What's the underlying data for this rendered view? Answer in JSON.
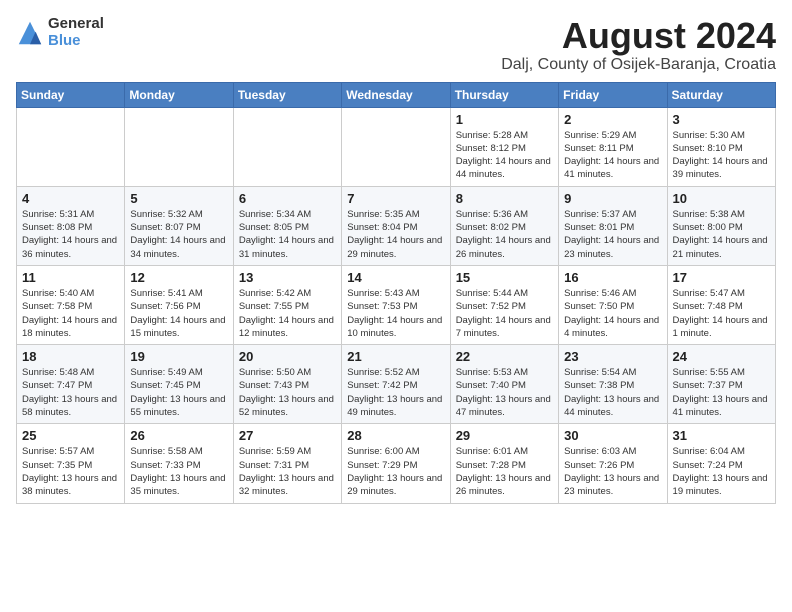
{
  "logo": {
    "general": "General",
    "blue": "Blue"
  },
  "title": "August 2024",
  "subtitle": "Dalj, County of Osijek-Baranja, Croatia",
  "days_of_week": [
    "Sunday",
    "Monday",
    "Tuesday",
    "Wednesday",
    "Thursday",
    "Friday",
    "Saturday"
  ],
  "weeks": [
    [
      {
        "day": "",
        "info": ""
      },
      {
        "day": "",
        "info": ""
      },
      {
        "day": "",
        "info": ""
      },
      {
        "day": "",
        "info": ""
      },
      {
        "day": "1",
        "info": "Sunrise: 5:28 AM\nSunset: 8:12 PM\nDaylight: 14 hours and 44 minutes."
      },
      {
        "day": "2",
        "info": "Sunrise: 5:29 AM\nSunset: 8:11 PM\nDaylight: 14 hours and 41 minutes."
      },
      {
        "day": "3",
        "info": "Sunrise: 5:30 AM\nSunset: 8:10 PM\nDaylight: 14 hours and 39 minutes."
      }
    ],
    [
      {
        "day": "4",
        "info": "Sunrise: 5:31 AM\nSunset: 8:08 PM\nDaylight: 14 hours and 36 minutes."
      },
      {
        "day": "5",
        "info": "Sunrise: 5:32 AM\nSunset: 8:07 PM\nDaylight: 14 hours and 34 minutes."
      },
      {
        "day": "6",
        "info": "Sunrise: 5:34 AM\nSunset: 8:05 PM\nDaylight: 14 hours and 31 minutes."
      },
      {
        "day": "7",
        "info": "Sunrise: 5:35 AM\nSunset: 8:04 PM\nDaylight: 14 hours and 29 minutes."
      },
      {
        "day": "8",
        "info": "Sunrise: 5:36 AM\nSunset: 8:02 PM\nDaylight: 14 hours and 26 minutes."
      },
      {
        "day": "9",
        "info": "Sunrise: 5:37 AM\nSunset: 8:01 PM\nDaylight: 14 hours and 23 minutes."
      },
      {
        "day": "10",
        "info": "Sunrise: 5:38 AM\nSunset: 8:00 PM\nDaylight: 14 hours and 21 minutes."
      }
    ],
    [
      {
        "day": "11",
        "info": "Sunrise: 5:40 AM\nSunset: 7:58 PM\nDaylight: 14 hours and 18 minutes."
      },
      {
        "day": "12",
        "info": "Sunrise: 5:41 AM\nSunset: 7:56 PM\nDaylight: 14 hours and 15 minutes."
      },
      {
        "day": "13",
        "info": "Sunrise: 5:42 AM\nSunset: 7:55 PM\nDaylight: 14 hours and 12 minutes."
      },
      {
        "day": "14",
        "info": "Sunrise: 5:43 AM\nSunset: 7:53 PM\nDaylight: 14 hours and 10 minutes."
      },
      {
        "day": "15",
        "info": "Sunrise: 5:44 AM\nSunset: 7:52 PM\nDaylight: 14 hours and 7 minutes."
      },
      {
        "day": "16",
        "info": "Sunrise: 5:46 AM\nSunset: 7:50 PM\nDaylight: 14 hours and 4 minutes."
      },
      {
        "day": "17",
        "info": "Sunrise: 5:47 AM\nSunset: 7:48 PM\nDaylight: 14 hours and 1 minute."
      }
    ],
    [
      {
        "day": "18",
        "info": "Sunrise: 5:48 AM\nSunset: 7:47 PM\nDaylight: 13 hours and 58 minutes."
      },
      {
        "day": "19",
        "info": "Sunrise: 5:49 AM\nSunset: 7:45 PM\nDaylight: 13 hours and 55 minutes."
      },
      {
        "day": "20",
        "info": "Sunrise: 5:50 AM\nSunset: 7:43 PM\nDaylight: 13 hours and 52 minutes."
      },
      {
        "day": "21",
        "info": "Sunrise: 5:52 AM\nSunset: 7:42 PM\nDaylight: 13 hours and 49 minutes."
      },
      {
        "day": "22",
        "info": "Sunrise: 5:53 AM\nSunset: 7:40 PM\nDaylight: 13 hours and 47 minutes."
      },
      {
        "day": "23",
        "info": "Sunrise: 5:54 AM\nSunset: 7:38 PM\nDaylight: 13 hours and 44 minutes."
      },
      {
        "day": "24",
        "info": "Sunrise: 5:55 AM\nSunset: 7:37 PM\nDaylight: 13 hours and 41 minutes."
      }
    ],
    [
      {
        "day": "25",
        "info": "Sunrise: 5:57 AM\nSunset: 7:35 PM\nDaylight: 13 hours and 38 minutes."
      },
      {
        "day": "26",
        "info": "Sunrise: 5:58 AM\nSunset: 7:33 PM\nDaylight: 13 hours and 35 minutes."
      },
      {
        "day": "27",
        "info": "Sunrise: 5:59 AM\nSunset: 7:31 PM\nDaylight: 13 hours and 32 minutes."
      },
      {
        "day": "28",
        "info": "Sunrise: 6:00 AM\nSunset: 7:29 PM\nDaylight: 13 hours and 29 minutes."
      },
      {
        "day": "29",
        "info": "Sunrise: 6:01 AM\nSunset: 7:28 PM\nDaylight: 13 hours and 26 minutes."
      },
      {
        "day": "30",
        "info": "Sunrise: 6:03 AM\nSunset: 7:26 PM\nDaylight: 13 hours and 23 minutes."
      },
      {
        "day": "31",
        "info": "Sunrise: 6:04 AM\nSunset: 7:24 PM\nDaylight: 13 hours and 19 minutes."
      }
    ]
  ]
}
